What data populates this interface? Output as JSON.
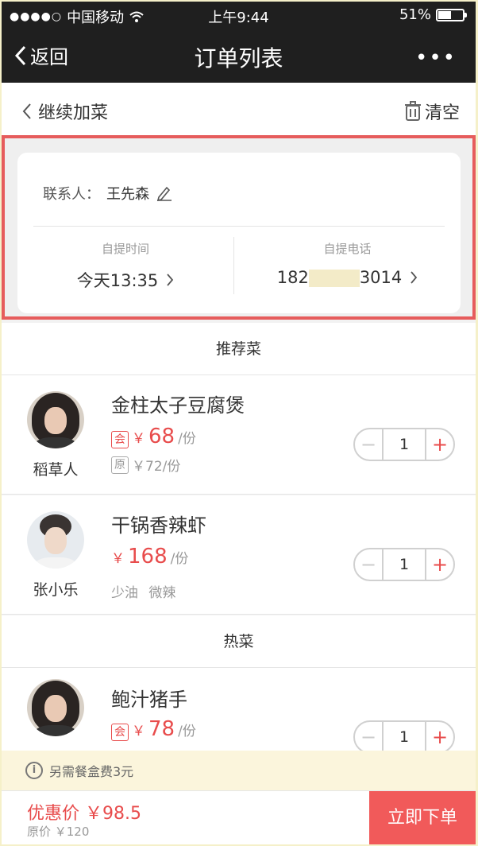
{
  "status_bar": {
    "signal": "●●●●○",
    "carrier": "中国移动",
    "time": "上午9:44",
    "battery": "51%",
    "battery_level": 0.51
  },
  "nav": {
    "back_label": "返回",
    "title": "订单列表",
    "more_label": "•••"
  },
  "subbar": {
    "continue_label": "继续加菜",
    "clear_label": "清空"
  },
  "contact": {
    "label": "联系人：",
    "name": "王先森",
    "pickup_time_label": "自提时间",
    "pickup_time": "今天13:35",
    "pickup_phone_label": "自提电话",
    "phone_prefix": "182",
    "phone_suffix": "3014"
  },
  "sections": [
    {
      "title": "推荐菜",
      "items": [
        {
          "person": "稻草人",
          "name": "金柱太子豆腐煲",
          "member_tag": "会",
          "currency": "￥",
          "price": "68",
          "unit": "/份",
          "orig_tag": "原",
          "orig_price": "￥72/份",
          "quantity": "1"
        },
        {
          "person": "张小乐",
          "name": "干锅香辣虾",
          "currency": "￥",
          "price": "168",
          "unit": "/份",
          "notes": "少油 微辣",
          "quantity": "1"
        }
      ]
    },
    {
      "title": "热菜",
      "items": [
        {
          "name": "鲍汁猪手",
          "member_tag": "会",
          "currency": "￥",
          "price": "78",
          "unit": "/份",
          "quantity": "1"
        }
      ]
    }
  ],
  "notice": {
    "icon": "i",
    "text": "另需餐盒费3元"
  },
  "footer": {
    "discount_label": "优惠价 ￥98.5",
    "original_label": "原价 ￥120",
    "order_button": "立即下单"
  },
  "stepper": {
    "minus": "−",
    "plus": "+"
  },
  "colors": {
    "accent": "#e84c4c",
    "highlight_border": "#e65c5c",
    "nav_bg": "#1f1f1f",
    "order_button_bg": "#f15a5a"
  }
}
